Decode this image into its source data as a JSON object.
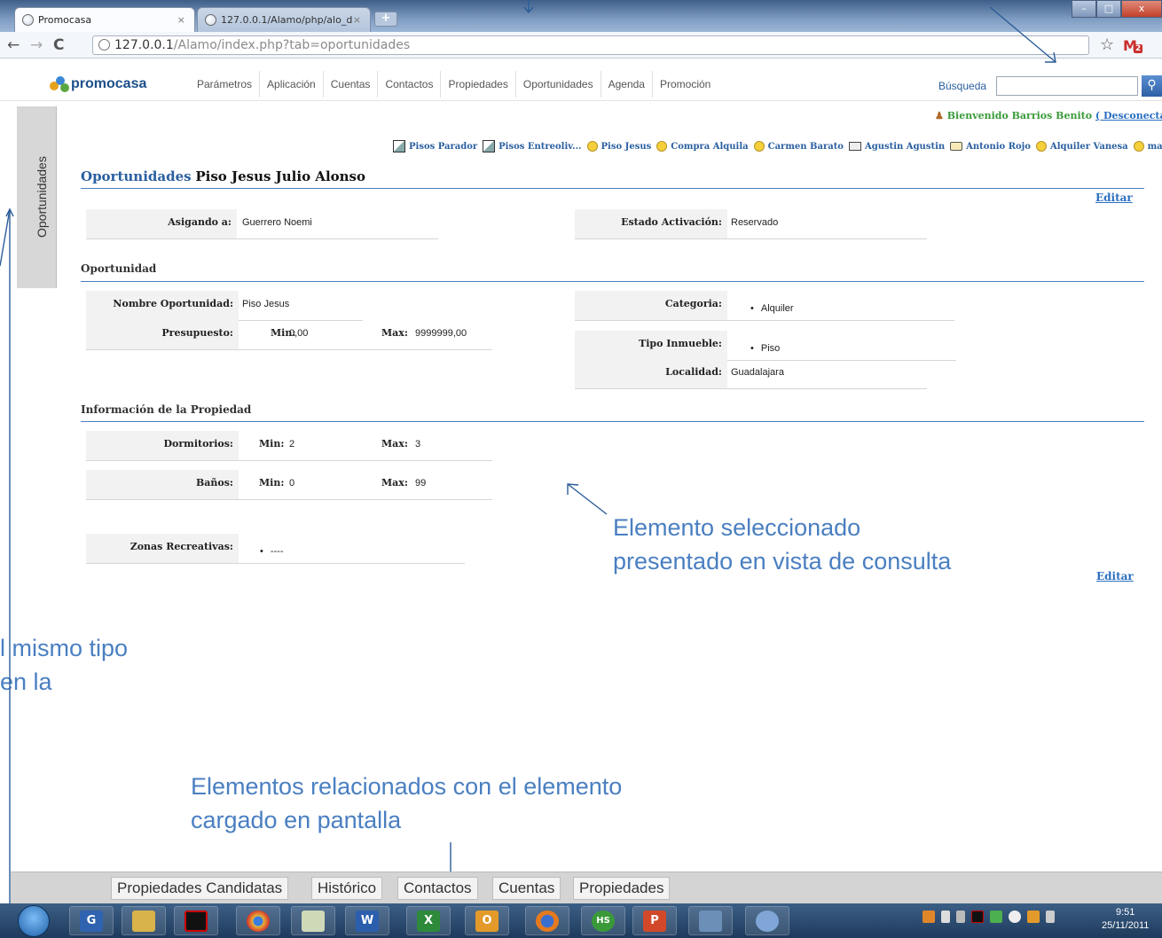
{
  "browser": {
    "tabs": [
      {
        "label": "Promocasa"
      },
      {
        "label": "127.0.0.1/Alamo/php/alo_d"
      }
    ],
    "address_host": "127.0.0.1",
    "address_rest": "/Alamo/index.php?tab=oportunidades",
    "gmail_count": "2"
  },
  "app": {
    "logo": "promocasa",
    "menu": [
      "Parámetros",
      "Aplicación",
      "Cuentas",
      "Contactos",
      "Propiedades",
      "Oportunidades",
      "Agenda",
      "Promoción"
    ],
    "search_label": "Búsqueda",
    "side_tab": "Oportunidades",
    "welcome": "Bienvenido Barrios Benito",
    "logout": "( Desconectar",
    "recent": [
      {
        "label": "Pisos Parador",
        "icon": "document-icon"
      },
      {
        "label": "Pisos Entreoliv...",
        "icon": "document-icon"
      },
      {
        "label": "Piso Jesus",
        "icon": "lightbulb-icon"
      },
      {
        "label": "Compra Alquila",
        "icon": "lightbulb-icon"
      },
      {
        "label": "Carmen Barato",
        "icon": "lightbulb-icon"
      },
      {
        "label": "Agustin Agustin",
        "icon": "envelope-icon"
      },
      {
        "label": "Antonio Rojo",
        "icon": "folder-icon"
      },
      {
        "label": "Alquiler Vanesa",
        "icon": "lightbulb-icon"
      },
      {
        "label": "mari",
        "icon": "lightbulb-icon"
      }
    ]
  },
  "detail": {
    "module": "Oportunidades",
    "record_name": "Piso Jesus Julio Alonso",
    "edit_label": "Editar",
    "assigned_label": "Asigando a:",
    "assigned_value": "Guerrero Noemi",
    "status_label": "Estado Activación:",
    "status_value": "Reservado",
    "section_opportunity": "Oportunidad",
    "name_label": "Nombre Oportunidad:",
    "name_value": "Piso Jesus",
    "budget_label": "Presupuesto:",
    "min_label": "Min:",
    "max_label": "Max:",
    "budget_min": "0,00",
    "budget_max": "9999999,00",
    "category_label": "Categoria:",
    "category_value": "Alquiler",
    "type_label": "Tipo Inmueble:",
    "type_value": "Piso",
    "locality_label": "Localidad:",
    "locality_value": "Guadalajara",
    "section_property": "Información de la Propiedad",
    "bedrooms_label": "Dormitorios:",
    "bedrooms_min": "2",
    "bedrooms_max": "3",
    "baths_label": "Baños:",
    "baths_min": "0",
    "baths_max": "99",
    "zones_label": "Zonas Recreativas:",
    "zones_value": "----"
  },
  "annotations": {
    "selected_line1": "Elemento seleccionado",
    "selected_line2": "presentado en vista de consulta",
    "left_line1": "l mismo tipo",
    "left_line2": "en la",
    "related_line1": "Elementos relacionados con el elemento",
    "related_line2": "cargado en pantalla"
  },
  "bottom_tabs": [
    "Propiedades Candidatas",
    "Histórico",
    "Contactos",
    "Cuentas",
    "Propiedades"
  ],
  "taskbar": {
    "time": "9:51",
    "date": "25/11/2011"
  }
}
